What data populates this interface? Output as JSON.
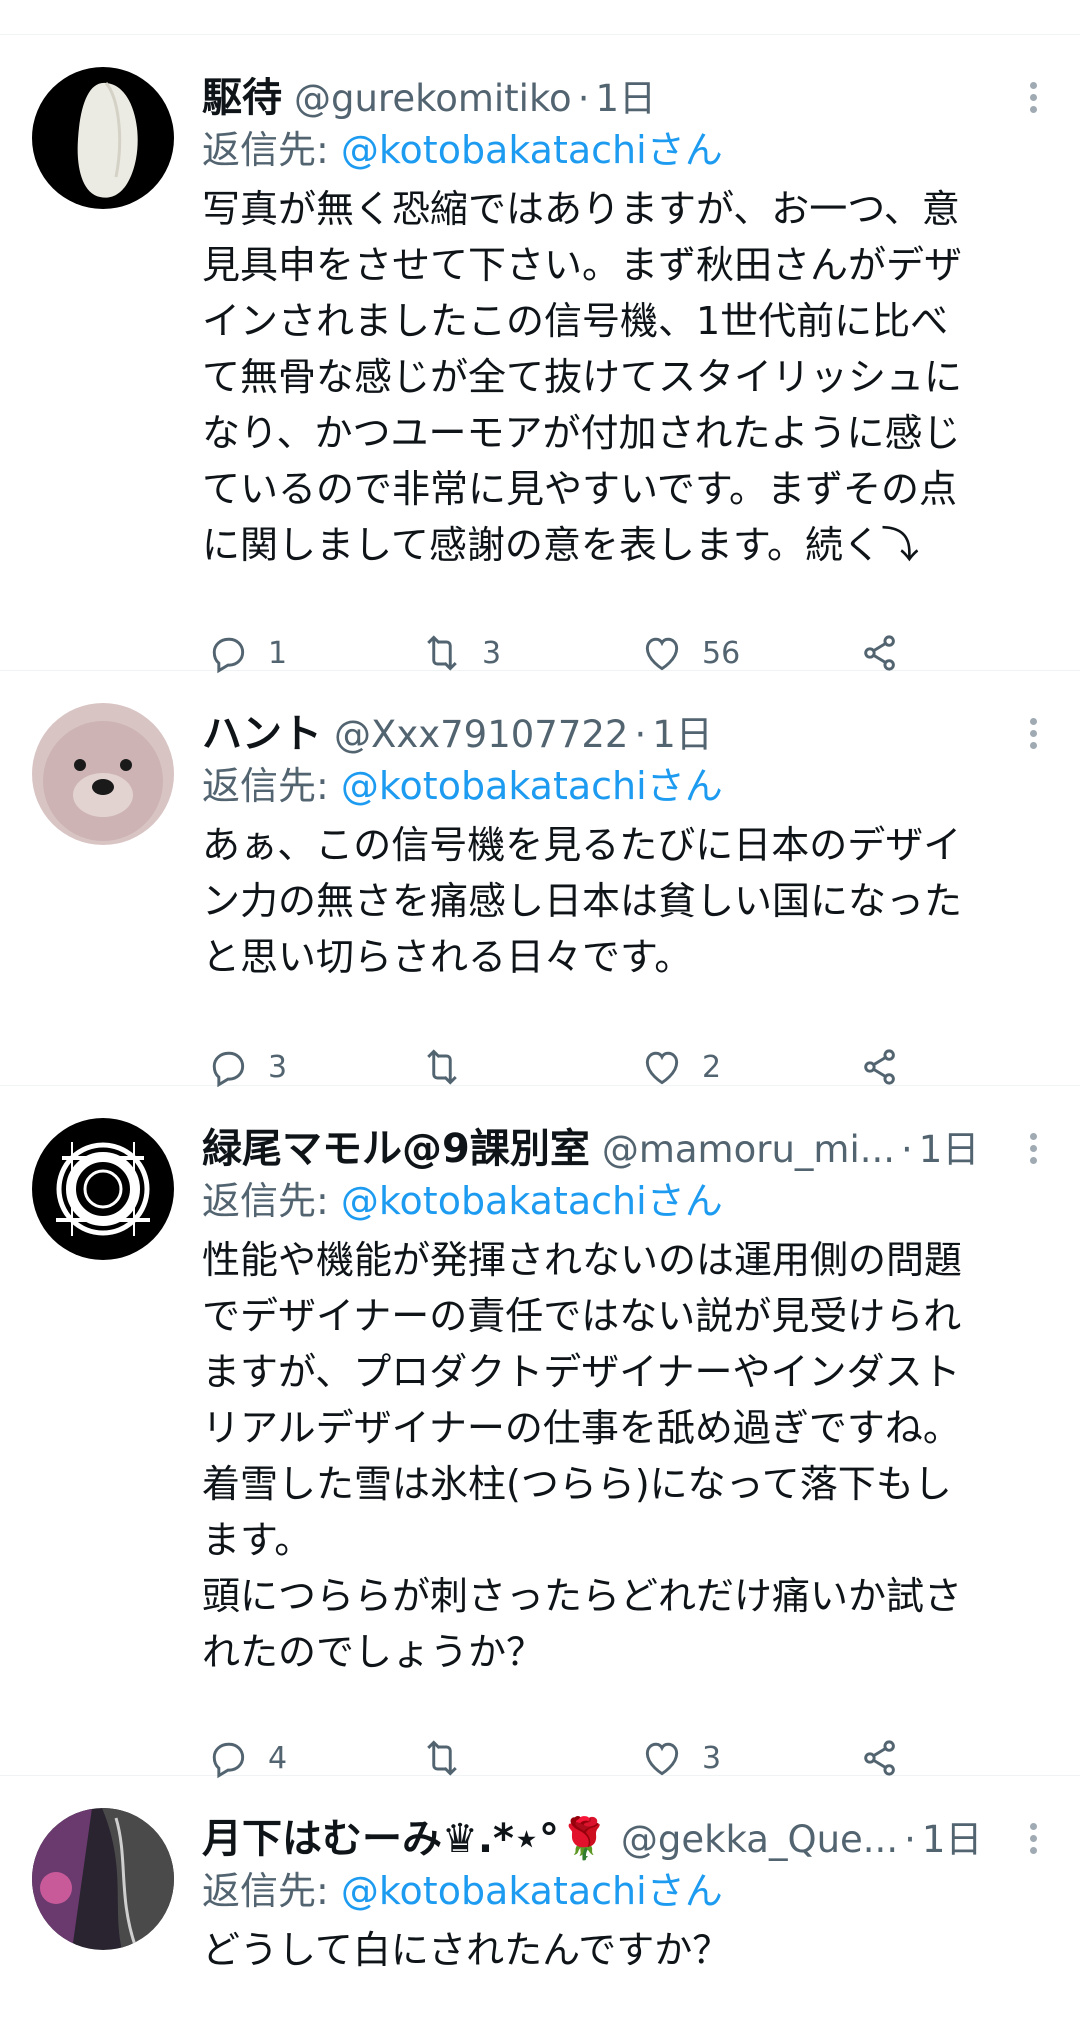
{
  "tweets": [
    {
      "name": "駆待",
      "handle": "@gurekomitiko",
      "time": "1日",
      "reply_prefix": "返信先: ",
      "reply_mention": "@kotobakatachiさん",
      "text": "写真が無く恐縮ではありますが、お一つ、意\n見具申をさせて下さい。まず秋田さんがデザ\nインされましたこの信号機、1世代前に比べ\nて無骨な感じが全て抜けてスタイリッシュに\nなり、かつユーモアが付加されたように感じ\nているので非常に見やすいです。まずその点\nに関しまして感謝の意を表します。続く⤵",
      "replies": "1",
      "retweets": "3",
      "likes": "56",
      "avatar_icon": "rice-grain-icon"
    },
    {
      "name": "ハント",
      "handle": "@Xxx79107722",
      "time": "1日",
      "reply_prefix": "返信先: ",
      "reply_mention": "@kotobakatachiさん",
      "text": "あぁ、この信号機を見るたびに日本のデザイ\nン力の無さを痛感し日本は貧しい国になった\nと思い切らされる日々です。",
      "replies": "3",
      "retweets": "",
      "likes": "2",
      "avatar_icon": "plush-bear-icon"
    },
    {
      "name": "緑尾マモル@9課別室",
      "handle": "@mamoru_mi...",
      "time": "1日",
      "reply_prefix": "返信先: ",
      "reply_mention": "@kotobakatachiさん",
      "text": "性能や機能が発揮されないのは運用側の問題\nでデザイナーの責任ではない説が見受けられ\nますが、プロダクトデザイナーやインダスト\nリアルデザイナーの仕事を舐め過ぎですね。\n着雪した雪は氷柱(つらら)になって落下もし\nます。\n頭につららが刺さったらどれだけ痛いか試さ\nれたのでしょうか？",
      "replies": "4",
      "retweets": "",
      "likes": "3",
      "avatar_icon": "ring-emblem-icon"
    },
    {
      "name": "月下はむーみ♛.*⋆°🌹",
      "handle": "@gekka_Que...",
      "time": "1日",
      "reply_prefix": "返信先: ",
      "reply_mention": "@kotobakatachiさん",
      "text": "どうして白にされたんですか？",
      "replies": "",
      "retweets": "",
      "likes": "",
      "avatar_icon": "portrait-icon"
    }
  ],
  "colors": {
    "text": "#0f1419",
    "secondary": "#536471",
    "link": "#1d9bf0",
    "divider": "#eff3f4"
  }
}
